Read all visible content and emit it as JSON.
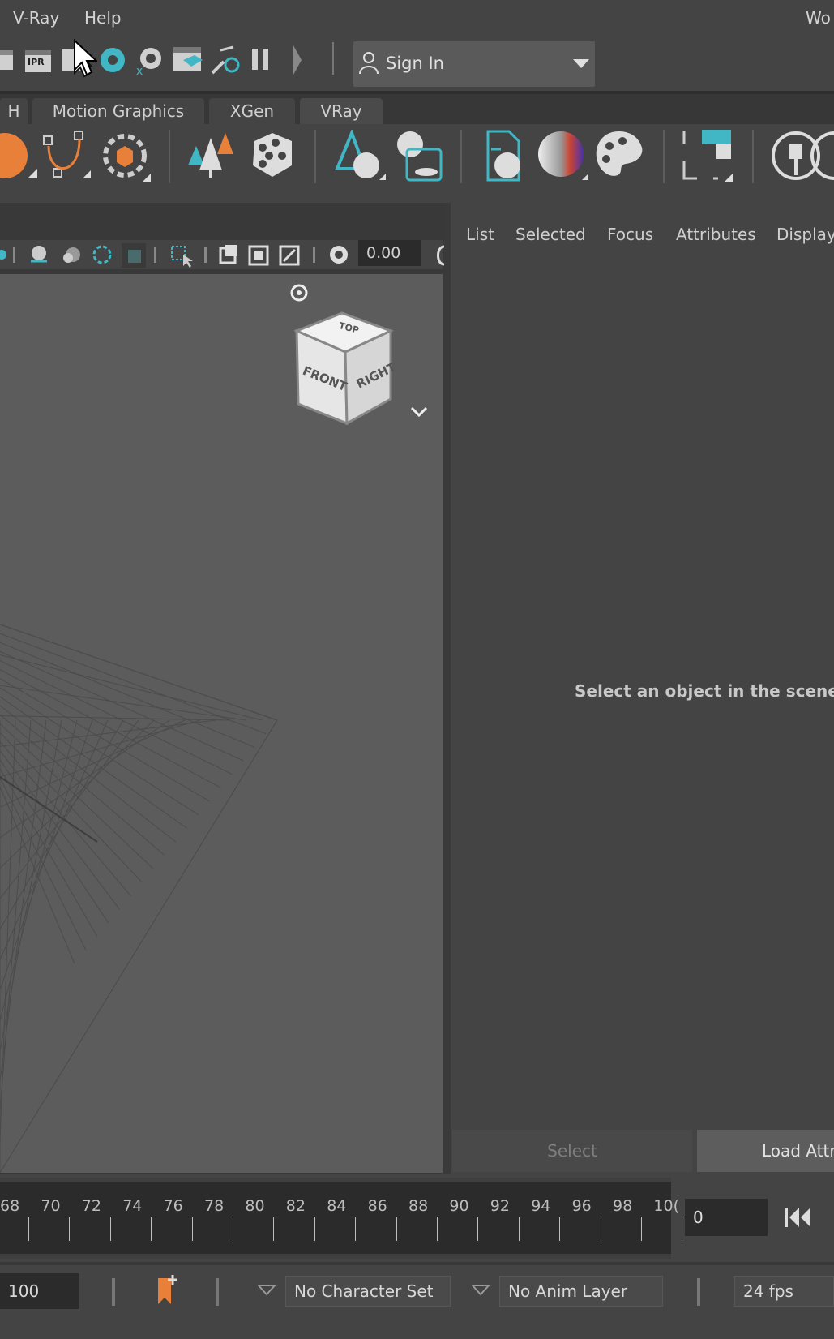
{
  "menubar": {
    "items": [
      "V-Ray",
      "Help"
    ],
    "workspace_fragment": "Wo"
  },
  "toolbar": {
    "ipr_label": "IPR",
    "signin_label": "Sign In"
  },
  "shelf_tabs": [
    "H",
    "Motion Graphics",
    "XGen",
    "VRay"
  ],
  "viewport": {
    "toolbar_value": "0.00",
    "viewcube": {
      "top": "TOP",
      "front": "FRONT",
      "right": "RIGHT"
    }
  },
  "attribute_editor": {
    "tabs": [
      "List",
      "Selected",
      "Focus",
      "Attributes",
      "Display"
    ],
    "message": "Select an object in the scene to",
    "select_button": "Select",
    "load_button": "Load Attr"
  },
  "timeline": {
    "ticks": [
      "68",
      "70",
      "72",
      "74",
      "76",
      "78",
      "80",
      "82",
      "84",
      "86",
      "88",
      "90",
      "92",
      "94",
      "96",
      "98",
      "10("
    ],
    "current_frame": "0"
  },
  "range_bar": {
    "end_value": "100",
    "character_set": "No Character Set",
    "anim_layer": "No Anim Layer",
    "fps": "24 fps"
  },
  "colors": {
    "accent_orange": "#e8803a",
    "accent_teal": "#41b6c4",
    "panel_bg": "#444444",
    "viewport_bg": "#5c5c5c"
  }
}
